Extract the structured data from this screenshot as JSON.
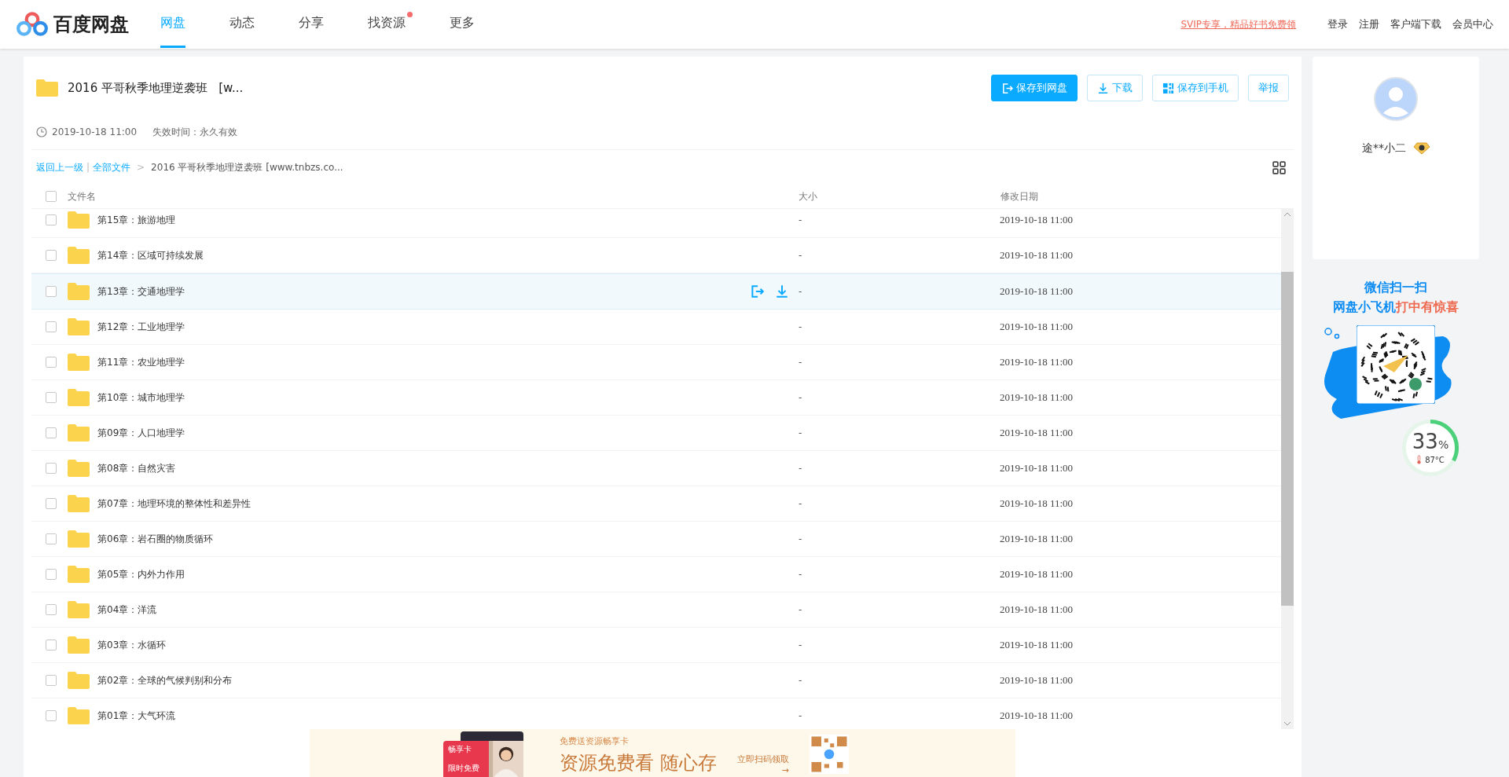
{
  "header": {
    "logo_text": "百度网盘",
    "nav": [
      {
        "label": "网盘",
        "selected": true,
        "badge": false
      },
      {
        "label": "动态",
        "selected": false,
        "badge": false
      },
      {
        "label": "分享",
        "selected": false,
        "badge": false
      },
      {
        "label": "找资源",
        "selected": false,
        "badge": true
      },
      {
        "label": "更多",
        "selected": false,
        "badge": false
      }
    ],
    "promo_link": "SVIP专享，精品好书免费领",
    "links": [
      "登录",
      "注册",
      "客户端下载",
      "会员中心"
    ]
  },
  "share": {
    "title": "2016 平哥秋季地理逆袭班   [w...",
    "time": "2019-10-18 11:00",
    "expiry": "失效时间：永久有效",
    "buttons": [
      {
        "label": "保存到网盘",
        "kind": "primary"
      },
      {
        "label": "下载",
        "kind": "plain"
      },
      {
        "label": "保存到手机",
        "kind": "plain"
      },
      {
        "label": "举报",
        "kind": "plain"
      }
    ]
  },
  "breadcrumb": {
    "back": "返回上一级",
    "separator": "|",
    "all": "全部文件",
    "arrow": ">",
    "current": "2016 平哥秋季地理逆袭班 [www.tnbzs.co..."
  },
  "table": {
    "select_all_checked": false,
    "columns": [
      "文件名",
      "大小",
      "修改日期"
    ],
    "rows": [
      {
        "name": "第15章：旅游地理",
        "size": "-",
        "date": "2019-10-18 11:00",
        "hovered": false
      },
      {
        "name": "第14章：区域可持续发展",
        "size": "-",
        "date": "2019-10-18 11:00",
        "hovered": false
      },
      {
        "name": "第13章：交通地理学",
        "size": "-",
        "date": "2019-10-18 11:00",
        "hovered": true
      },
      {
        "name": "第12章：工业地理学",
        "size": "-",
        "date": "2019-10-18 11:00",
        "hovered": false
      },
      {
        "name": "第11章：农业地理学",
        "size": "-",
        "date": "2019-10-18 11:00",
        "hovered": false
      },
      {
        "name": "第10章：城市地理学",
        "size": "-",
        "date": "2019-10-18 11:00",
        "hovered": false
      },
      {
        "name": "第09章：人口地理学",
        "size": "-",
        "date": "2019-10-18 11:00",
        "hovered": false
      },
      {
        "name": "第08章：自然灾害",
        "size": "-",
        "date": "2019-10-18 11:00",
        "hovered": false
      },
      {
        "name": "第07章：地理环境的整体性和差异性",
        "size": "-",
        "date": "2019-10-18 11:00",
        "hovered": false
      },
      {
        "name": "第06章：岩石圈的物质循环",
        "size": "-",
        "date": "2019-10-18 11:00",
        "hovered": false
      },
      {
        "name": "第05章：内外力作用",
        "size": "-",
        "date": "2019-10-18 11:00",
        "hovered": false
      },
      {
        "name": "第04章：洋流",
        "size": "-",
        "date": "2019-10-18 11:00",
        "hovered": false
      },
      {
        "name": "第03章：水循环",
        "size": "-",
        "date": "2019-10-18 11:00",
        "hovered": false
      },
      {
        "name": "第02章：全球的气候判别和分布",
        "size": "-",
        "date": "2019-10-18 11:00",
        "hovered": false
      },
      {
        "name": "第01章：大气环流",
        "size": "-",
        "date": "2019-10-18 11:00",
        "hovered": false
      }
    ]
  },
  "profile": {
    "username": "途**小二"
  },
  "promo": {
    "line1": "微信扫一扫",
    "line2_blue": "网盘小飞机",
    "line2_red": "打中有惊喜"
  },
  "meter": {
    "reading": "33",
    "unit": "%",
    "level": 0.33,
    "temperature": "87°C"
  },
  "banner": {
    "card_title": "畅享卡",
    "card_note": "限时免费",
    "kicker": "免费送资源畅享卡",
    "headline": "资源免费看 随心存",
    "cta": "立即扫码领取",
    "arrow": "→"
  }
}
